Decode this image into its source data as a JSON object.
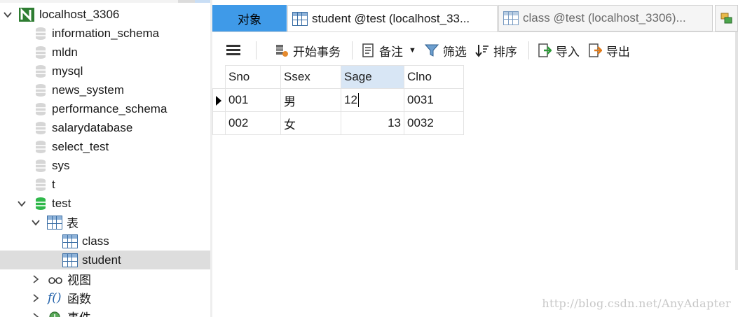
{
  "navigator": {
    "connection": "localhost_3306",
    "databases": [
      "information_schema",
      "mldn",
      "mysql",
      "news_system",
      "performance_schema",
      "salarydatabase",
      "select_test",
      "sys",
      "t"
    ],
    "open_db": "test",
    "tables_group": "表",
    "tables": [
      "class",
      "student"
    ],
    "selected_table": "student",
    "views_group": "视图",
    "functions_group": "函数",
    "events_group": "事件"
  },
  "tabs": {
    "objects": "对象",
    "student": "student @test (localhost_33...",
    "class": "class @test (localhost_3306)..."
  },
  "toolbar": {
    "begin_transaction": "开始事务",
    "memo": "备注",
    "filter": "筛选",
    "sort": "排序",
    "import": "导入",
    "export": "导出"
  },
  "grid": {
    "columns": [
      "Sno",
      "Ssex",
      "Sage",
      "Clno"
    ],
    "active_column": "Sage",
    "rows": [
      {
        "Sno": "001",
        "Ssex": "男",
        "Sage": "12",
        "Clno": "0031"
      },
      {
        "Sno": "002",
        "Ssex": "女",
        "Sage": "13",
        "Clno": "0032"
      }
    ]
  },
  "watermark": "http://blog.csdn.net/AnyAdapter",
  "colors": {
    "objects_tab": "#3f9ae8",
    "selection": "#dddddd",
    "active_header": "#d8e6f5",
    "db_open": "#2fb84a"
  }
}
